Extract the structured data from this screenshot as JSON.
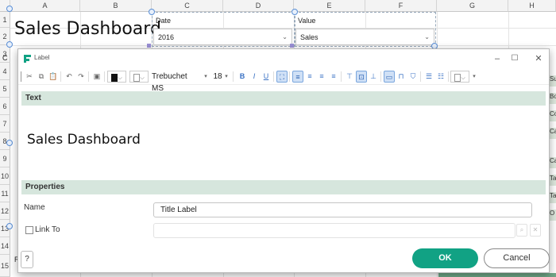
{
  "spreadsheet": {
    "columns": [
      "A",
      "B",
      "C",
      "D",
      "E",
      "F",
      "G",
      "H"
    ],
    "rows": [
      "1",
      "2",
      "3",
      "4",
      "5",
      "6",
      "7",
      "8",
      "9",
      "10",
      "11",
      "12",
      "13",
      "14",
      "15"
    ],
    "title_widget": "Sales Dashboard",
    "date_filter": {
      "label": "Date",
      "value": "2016"
    },
    "value_filter": {
      "label": "Value",
      "value": "Sales"
    },
    "left_cut": [
      "C",
      "C",
      "T",
      "F",
      "R"
    ],
    "right_cut": [
      "Su",
      "Bo",
      "Co",
      "Ca",
      "Ca",
      "Ta",
      "Ta",
      "O"
    ]
  },
  "dialog": {
    "title": "Label",
    "font_name": "Trebuchet MS",
    "font_size": "18",
    "font_size_value": "18",
    "text_section": "Text",
    "preview_text": "Sales Dashboard",
    "properties_section": "Properties",
    "name_label": "Name",
    "name_value": "Title Label",
    "link_label": "Link To",
    "link_value": "",
    "help_label": "?",
    "ok_label": "OK",
    "cancel_label": "Cancel",
    "text_color": "#111111",
    "accent_color": "#11a284",
    "section_color": "#d6e6dd"
  }
}
